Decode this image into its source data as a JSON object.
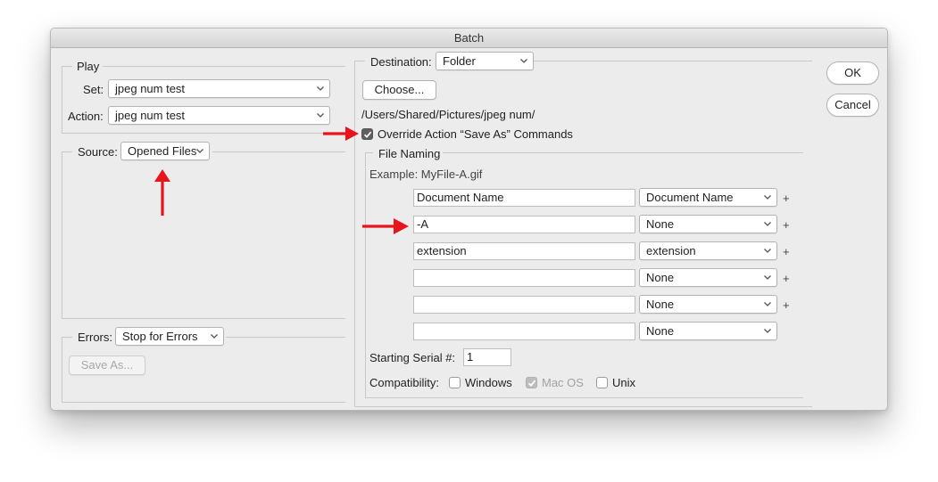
{
  "window": {
    "title": "Batch"
  },
  "play": {
    "legend": "Play",
    "set_label": "Set:",
    "set_value": "jpeg num test",
    "action_label": "Action:",
    "action_value": "jpeg num test"
  },
  "source": {
    "label": "Source:",
    "value": "Opened Files"
  },
  "errors": {
    "label": "Errors:",
    "value": "Stop for Errors",
    "save_as_label": "Save As..."
  },
  "destination": {
    "label": "Destination:",
    "value": "Folder",
    "choose_label": "Choose...",
    "path": "/Users/Shared/Pictures/jpeg num/",
    "override_label": "Override Action “Save As” Commands",
    "override_checked": true
  },
  "file_naming": {
    "legend": "File Naming",
    "example": "Example: MyFile-A.gif",
    "rows": [
      {
        "text": "Document Name",
        "select": "Document Name",
        "plus": "+"
      },
      {
        "text": "-A",
        "select": "None",
        "plus": "+"
      },
      {
        "text": "extension",
        "select": "extension",
        "plus": "+"
      },
      {
        "text": "",
        "select": "None",
        "plus": "+"
      },
      {
        "text": "",
        "select": "None",
        "plus": "+"
      },
      {
        "text": "",
        "select": "None",
        "plus": ""
      }
    ],
    "serial_label": "Starting Serial #:",
    "serial_value": "1",
    "compat_label": "Compatibility:",
    "compat": [
      {
        "label": "Windows",
        "checked": false,
        "disabled": false
      },
      {
        "label": "Mac OS",
        "checked": true,
        "disabled": true
      },
      {
        "label": "Unix",
        "checked": false,
        "disabled": false
      }
    ]
  },
  "buttons": {
    "ok": "OK",
    "cancel": "Cancel"
  },
  "colors": {
    "annotation_arrow": "#e8141b",
    "window_bg": "#ececec"
  }
}
